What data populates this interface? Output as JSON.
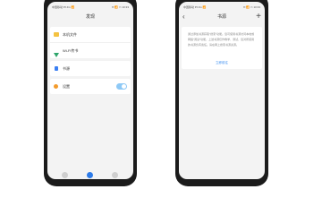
{
  "left_phone": {
    "status": {
      "carrier": "中国移动 ▾▾ 4G 📶",
      "system": "✉ 📶 ▭ 10:33"
    },
    "title": "发现",
    "menu": [
      {
        "label": "本机文件",
        "icon": "folder-icon",
        "color": "#f4c241"
      },
      {
        "label": "Wi-Fi传书",
        "icon": "wifi-icon",
        "color": "#2ea56b"
      },
      {
        "label": "书源",
        "icon": "book-source-icon",
        "color": "#3b7ff2"
      },
      {
        "label": "设置",
        "icon": "gear-icon",
        "color": "#f39b2c"
      }
    ],
    "settings_toggle_on": true,
    "tabs": [
      {
        "icon": "tab-home-icon",
        "color": "#cfcfcf"
      },
      {
        "icon": "tab-discover-icon",
        "color": "#2d7be8"
      },
      {
        "icon": "tab-profile-icon",
        "color": "#cfcfcf"
      }
    ]
  },
  "right_phone": {
    "status": {
      "carrier": "中国移动 ▾▾ 4G 📶",
      "system": "✉ 📶 ▭ 10:33"
    },
    "title": "书源",
    "back_glyph": "‹",
    "add_glyph": "+",
    "description": "通过添加书源获取\"搜索\"功能。您可使用书源访问本地或网络\"阅读\"功能，上述书源仅作教学、测试，您对所使用的书源负有责任。请在网上搜索书源资源。",
    "link_label": "立即前往"
  }
}
